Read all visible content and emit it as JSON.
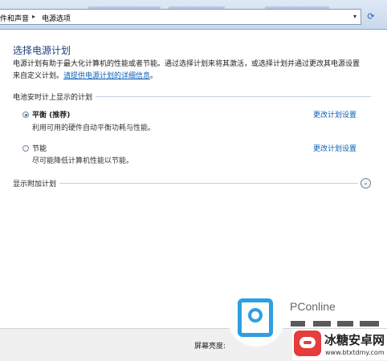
{
  "address_bar": {
    "crumbs": [
      "件和声音",
      "电源选项"
    ],
    "refresh_icon": "refresh-icon",
    "dropdown_icon": "chevron-down-icon"
  },
  "main": {
    "title": "选择电源计划",
    "desc_text": "电源计划有助于最大化计算机的性能或者节能。通过选择计划来将其激活，或选择计划并通过更改其电源设置来自定义计划。",
    "desc_link": "请提供电源计划的详细信息",
    "desc_end": "。",
    "battery_section_label": "电池安时计上显示的计划",
    "plans": [
      {
        "name": "平衡 (推荐)",
        "description": "利用可用的硬件自动平衡功耗与性能。",
        "link": "更改计划设置",
        "selected": true
      },
      {
        "name": "节能",
        "description": "尽可能降低计算机性能以节能。",
        "link": "更改计划设置",
        "selected": false
      }
    ],
    "additional_section_label": "显示附加计划"
  },
  "bottom_bar": {
    "brightness_label": "屏幕亮度:"
  },
  "watermark": {
    "pconline": "PConline",
    "site_name": "冰糖安卓网",
    "site_url": "www.btxtdmy.com"
  },
  "colors": {
    "title": "#1e3f7a",
    "link": "#0a5eb8",
    "watermark_blue": "#2e9fe0",
    "watermark_red": "#e63c3c"
  }
}
